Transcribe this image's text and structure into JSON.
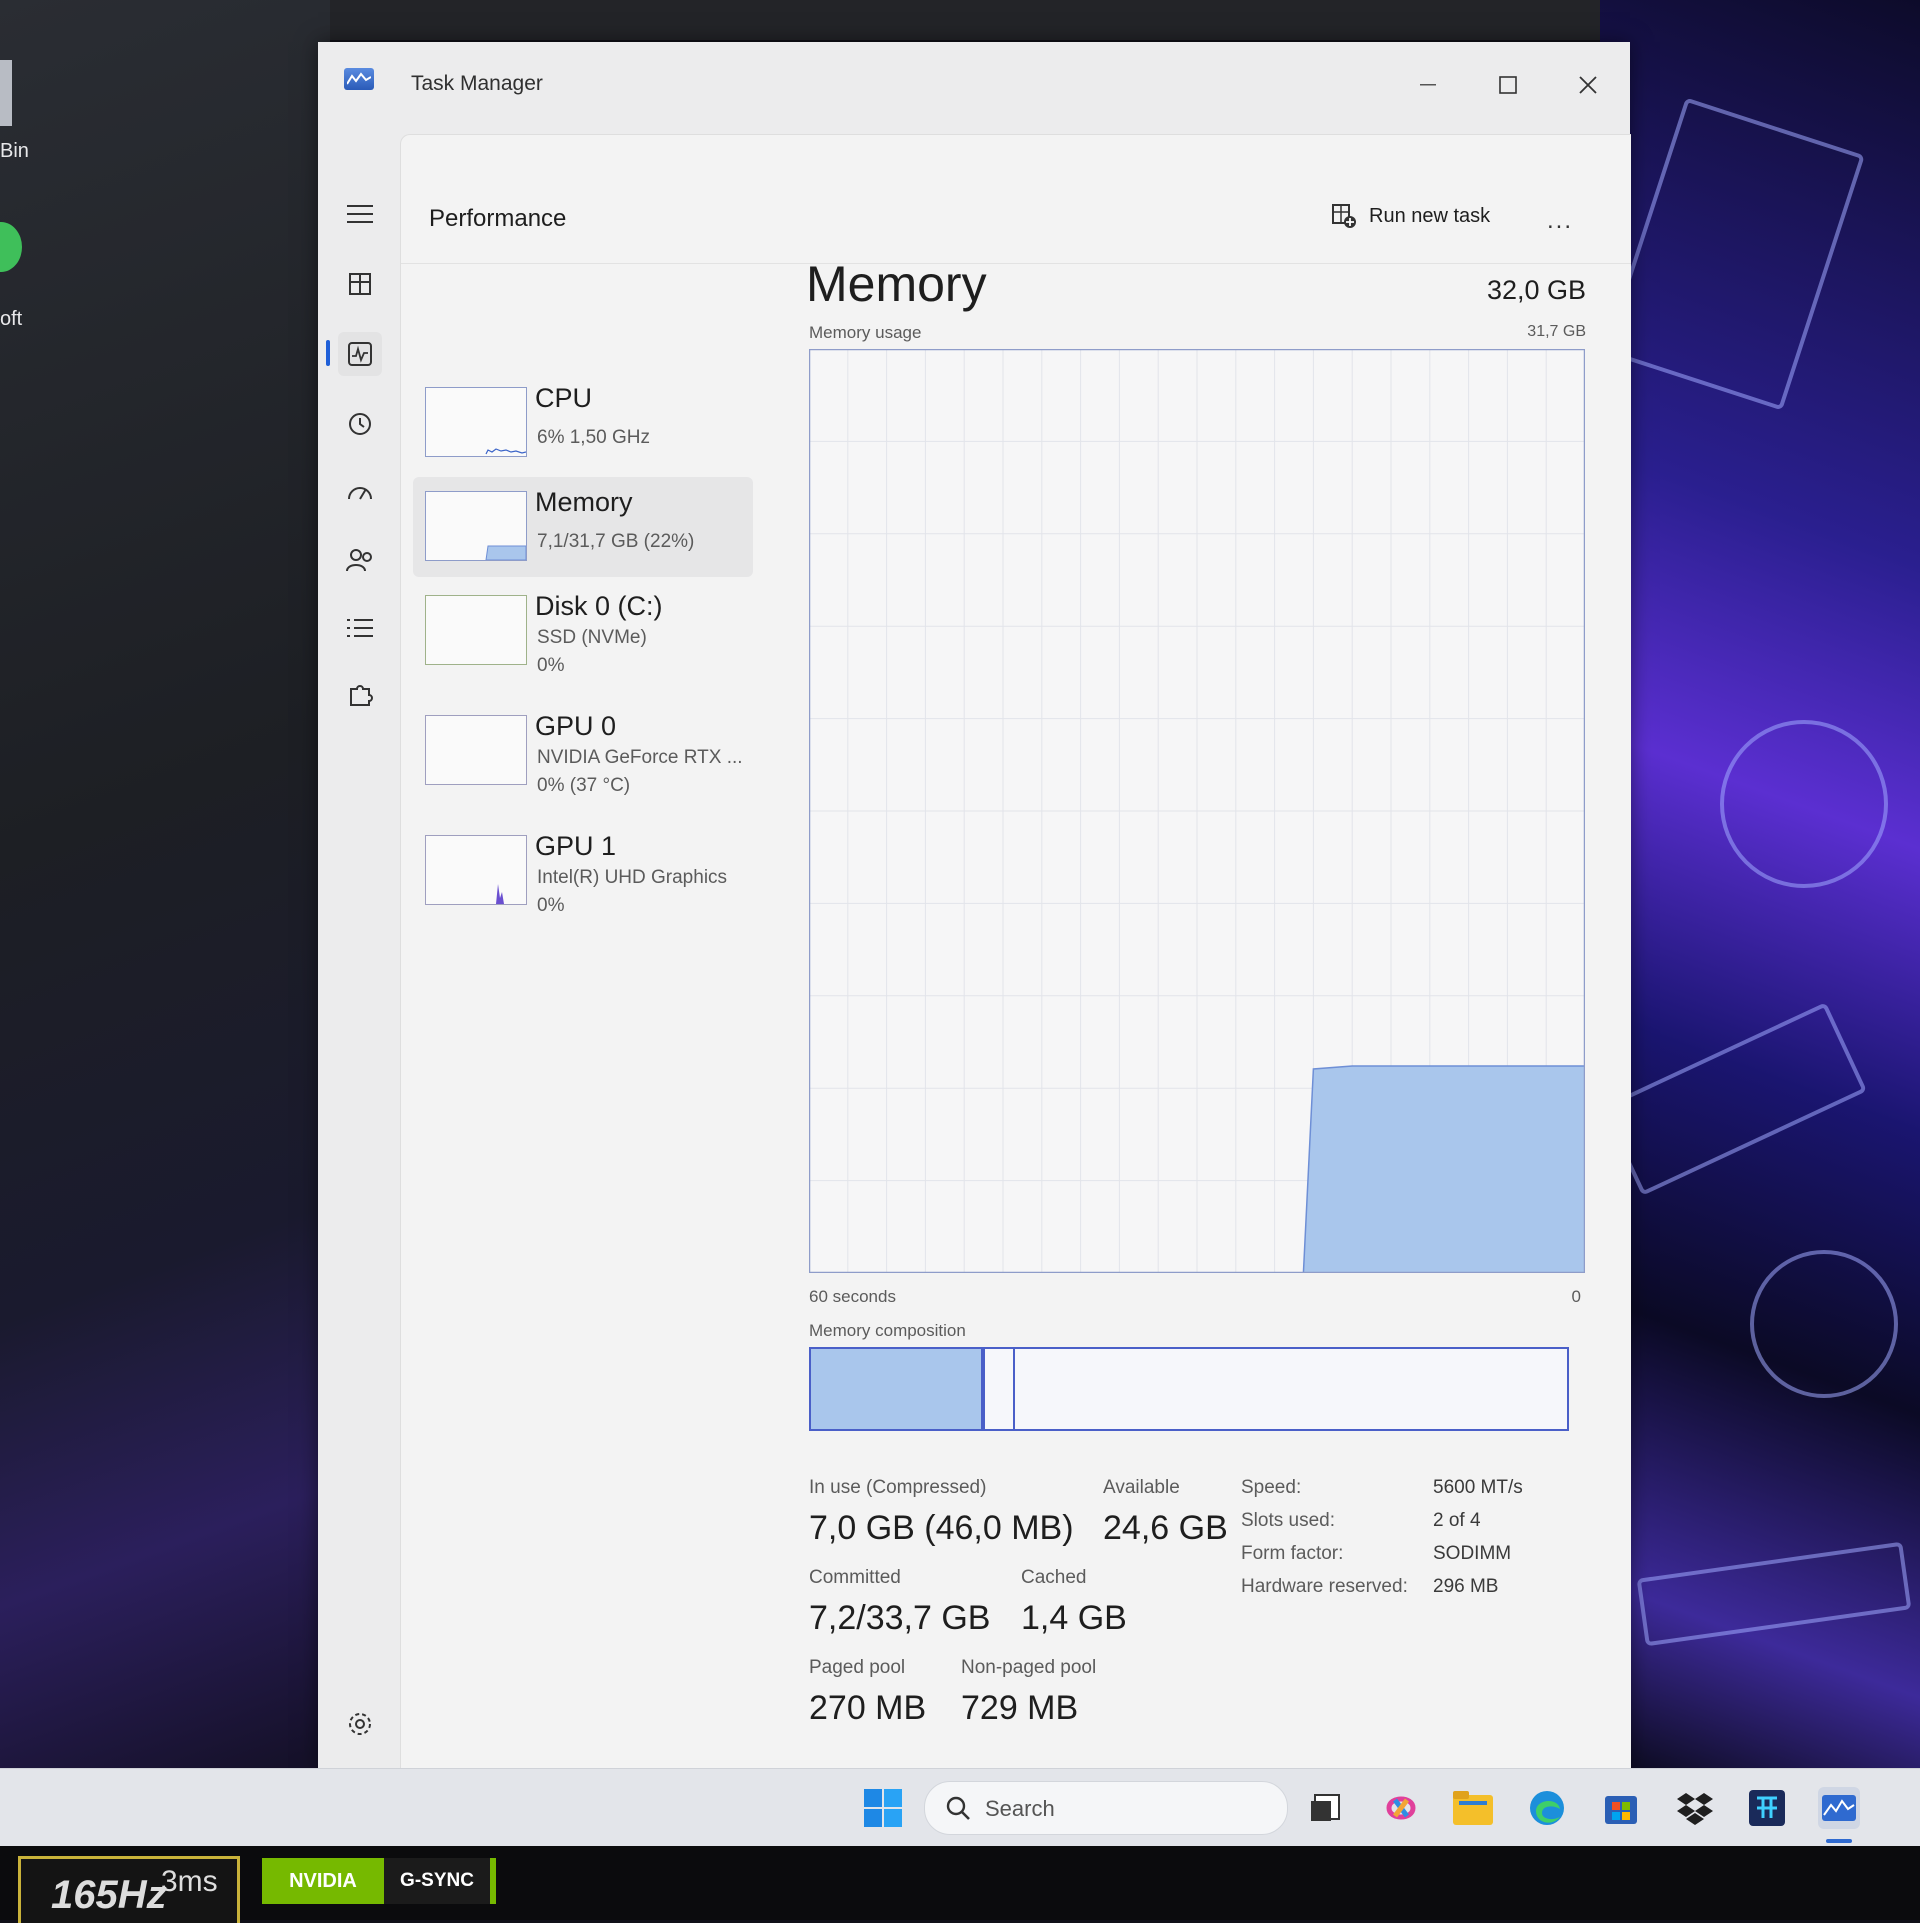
{
  "desktop": {
    "icon_labels": [
      "Bin",
      "oft"
    ]
  },
  "window": {
    "title": "Task Manager"
  },
  "header": {
    "page_title": "Performance",
    "run_new_task": "Run new task",
    "more": "..."
  },
  "perf_list": [
    {
      "name": "CPU",
      "line1": "6%  1,50 GHz",
      "line2": ""
    },
    {
      "name": "Memory",
      "line1": "7,1/31,7 GB (22%)",
      "line2": ""
    },
    {
      "name": "Disk 0 (C:)",
      "line1": "SSD (NVMe)",
      "line2": "0%"
    },
    {
      "name": "GPU 0",
      "line1": "NVIDIA GeForce RTX ...",
      "line2": "0%  (37 °C)"
    },
    {
      "name": "GPU 1",
      "line1": "Intel(R) UHD Graphics",
      "line2": "0%"
    }
  ],
  "memory": {
    "heading": "Memory",
    "total": "32,0 GB",
    "usage_label": "Memory usage",
    "usage_max": "31,7 GB",
    "axis_left": "60 seconds",
    "axis_right": "0",
    "composition_label": "Memory composition",
    "stats": {
      "in_use_label": "In use (Compressed)",
      "in_use_value": "7,0 GB (46,0 MB)",
      "available_label": "Available",
      "available_value": "24,6 GB",
      "committed_label": "Committed",
      "committed_value": "7,2/33,7 GB",
      "cached_label": "Cached",
      "cached_value": "1,4 GB",
      "paged_label": "Paged pool",
      "paged_value": "270 MB",
      "nonpaged_label": "Non-paged pool",
      "nonpaged_value": "729 MB"
    },
    "specs": [
      {
        "label": "Speed:",
        "value": "5600 MT/s"
      },
      {
        "label": "Slots used:",
        "value": "2 of 4"
      },
      {
        "label": "Form factor:",
        "value": "SODIMM"
      },
      {
        "label": "Hardware reserved:",
        "value": "296 MB"
      }
    ]
  },
  "chart_data": {
    "type": "area",
    "title": "Memory usage",
    "xlabel": "",
    "ylabel": "",
    "x_range_labels": [
      "60 seconds",
      "0"
    ],
    "ylim": [
      0,
      31.7
    ],
    "y_unit": "GB",
    "x": [
      60,
      57,
      54,
      51,
      48,
      45,
      42,
      39,
      36,
      33,
      30,
      27,
      24,
      21,
      18,
      15,
      12,
      9,
      6,
      3,
      0
    ],
    "values": [
      null,
      null,
      null,
      null,
      null,
      null,
      null,
      null,
      null,
      null,
      null,
      null,
      null,
      7.0,
      7.1,
      7.1,
      7.1,
      7.1,
      7.1,
      7.1,
      7.1
    ],
    "grid": true,
    "color": "#a9c6ec"
  },
  "taskbar": {
    "search_placeholder": "Search"
  },
  "monitor": {
    "refresh_badge": "165Hz",
    "response_badge": "3ms",
    "nvidia": "NVIDIA",
    "gsync": "G-SYNC"
  },
  "colors": {
    "accent": "#1f5fd8",
    "graph_fill": "#a9c6ec",
    "graph_border": "#8e9cc9",
    "composition_border": "#4a5fc8"
  }
}
